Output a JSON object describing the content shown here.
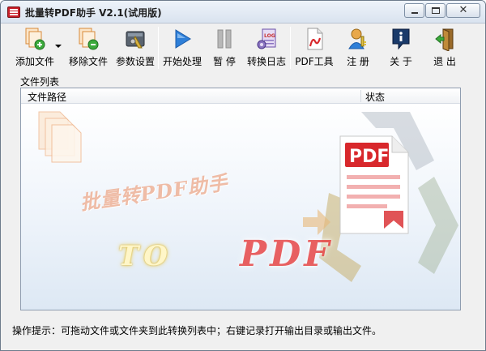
{
  "window": {
    "title": "批量转PDF助手 V2.1(试用版)"
  },
  "toolbar": {
    "items": [
      {
        "label": "添加文件",
        "icon": "add-file-icon"
      },
      {
        "label": "移除文件",
        "icon": "remove-file-icon"
      },
      {
        "label": "参数设置",
        "icon": "settings-icon"
      },
      {
        "label": "开始处理",
        "icon": "play-icon"
      },
      {
        "label": "暂 停",
        "icon": "pause-icon"
      },
      {
        "label": "转换日志",
        "icon": "log-icon"
      },
      {
        "label": "PDF工具",
        "icon": "pdf-tool-icon"
      },
      {
        "label": "注 册",
        "icon": "register-icon"
      },
      {
        "label": "关 于",
        "icon": "about-icon"
      },
      {
        "label": "退 出",
        "icon": "exit-icon"
      }
    ]
  },
  "file_list": {
    "group_label": "文件列表",
    "columns": [
      "文件路径",
      "状态"
    ],
    "rows": [],
    "watermark": {
      "title": "批量转PDF助手",
      "to": "TO",
      "pdf": "PDF",
      "badge": "PDF"
    }
  },
  "status": {
    "hint": "操作提示：可拖动文件或文件夹到此转换列表中；右键记录打开输出目录或输出文件。"
  },
  "colors": {
    "accent_blue": "#2e7fd8",
    "pdf_red": "#d8282c",
    "recycle_gray": "#a8b0b8"
  }
}
